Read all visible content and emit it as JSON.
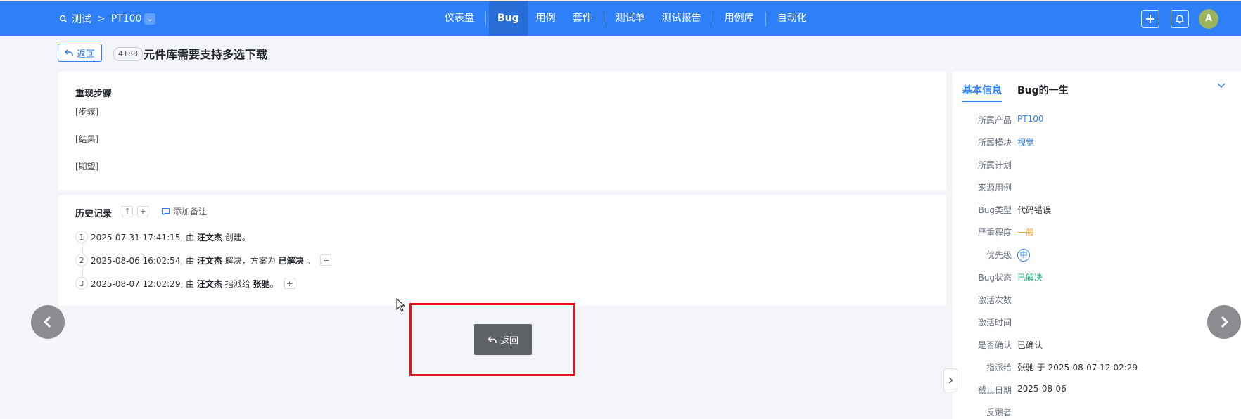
{
  "topbar": {
    "breadcrumb": {
      "project": "测试",
      "separator": ">",
      "product": "PT100"
    },
    "nav": [
      {
        "label": "仪表盘",
        "active": false
      },
      {
        "label": "Bug",
        "active": true
      },
      {
        "label": "用例",
        "active": false
      },
      {
        "label": "套件",
        "active": false
      },
      {
        "label": "测试单",
        "active": false
      },
      {
        "label": "测试报告",
        "active": false
      },
      {
        "label": "用例库",
        "active": false
      },
      {
        "label": "自动化",
        "active": false
      }
    ],
    "avatar_initial": "A",
    "accent_color": "#2e7ff8"
  },
  "header": {
    "back_label": "返回",
    "bug_id": "4188",
    "bug_title": "元件库需要支持多选下载"
  },
  "steps": {
    "title": "重现步骤",
    "step": "[步骤]",
    "result": "[结果]",
    "expect": "[期望]"
  },
  "history": {
    "title": "历史记录",
    "add_note": "添加备注",
    "entries": [
      {
        "num": "1",
        "time": "2025-07-31 17:41:15, 由",
        "actor": "汪文杰",
        "action": "创建。"
      },
      {
        "num": "2",
        "time": "2025-08-06 16:02:54, 由",
        "actor": "汪文杰",
        "action": "解决，方案为",
        "target": "已解决",
        "tail": "。"
      },
      {
        "num": "3",
        "time": "2025-08-07 12:02:29, 由",
        "actor": "汪文杰",
        "action": "指派给",
        "target": "张驰",
        "tail": "。"
      }
    ]
  },
  "side": {
    "tab_basic": "基本信息",
    "tab_life": "Bug的一生",
    "rows": [
      {
        "label": "所属产品",
        "value": "PT100"
      },
      {
        "label": "所属模块",
        "value": "视觉"
      },
      {
        "label": "所属计划",
        "value": ""
      },
      {
        "label": "来源用例",
        "value": ""
      },
      {
        "label": "Bug类型",
        "value": "代码错误"
      },
      {
        "label": "严重程度",
        "value": "一般"
      },
      {
        "label": "优先级",
        "value": "中"
      },
      {
        "label": "Bug状态",
        "value": "已解决"
      },
      {
        "label": "激活次数",
        "value": ""
      },
      {
        "label": "激活时间",
        "value": ""
      },
      {
        "label": "是否确认",
        "value": "已确认"
      },
      {
        "label": "指派给",
        "value": "张驰 于 2025-08-07 12:02:29"
      },
      {
        "label": "截止日期",
        "value": "2025-08-06"
      },
      {
        "label": "反馈者",
        "value": ""
      }
    ]
  },
  "floating": {
    "back_label": "返回",
    "highlight_color": "#e8111c"
  }
}
